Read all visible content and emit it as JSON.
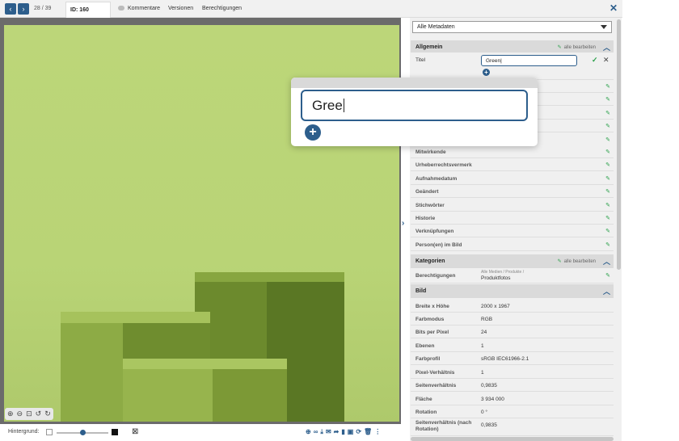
{
  "topbar": {
    "prev_icon": "chevron-left-icon",
    "next_icon": "chevron-right-icon",
    "counter": "28 / 39",
    "id_tab": "ID: 160",
    "tabs": [
      {
        "label": "Kommentare",
        "icon": "comment-icon"
      },
      {
        "label": "Versionen"
      },
      {
        "label": "Berechtigungen"
      }
    ],
    "close_icon": "close-icon"
  },
  "viewer": {
    "tools": [
      "zoom-in-icon",
      "zoom-out-icon",
      "fit-icon",
      "rotate-left-icon",
      "rotate-right-icon"
    ]
  },
  "bottombar": {
    "background_label": "Hintergrund:",
    "background_slider_level": 0.5,
    "actions": [
      "add-icon",
      "link-icon",
      "download-icon",
      "mail-icon",
      "share-icon",
      "import-icon",
      "print-icon",
      "refresh-icon",
      "delete-icon",
      "more-icon"
    ]
  },
  "panel": {
    "filter_select": "Alle Metadaten",
    "sections": {
      "allgemein": {
        "title": "Allgemein",
        "edit_all": "alle bearbeiten"
      },
      "kategorien": {
        "title": "Kategorien",
        "edit_all": "alle bearbeiten"
      },
      "bild": {
        "title": "Bild"
      }
    },
    "titel": {
      "label": "Titel",
      "value": "Green"
    },
    "allgemein_rows": [
      "Mitwirkende",
      "Urheberrechtsvermerk",
      "Aufnahmedatum",
      "Geändert",
      "Stichwörter",
      "Historie",
      "Verknüpfungen",
      "Person(en) im Bild"
    ],
    "berechtigungen": {
      "label": "Berechtigungen",
      "path": "Alle Medien / Produkte /",
      "value": "Produktfotos"
    },
    "bild_rows": [
      {
        "label": "Breite x Höhe",
        "value": "2000  x  1967"
      },
      {
        "label": "Farbmodus",
        "value": "RGB"
      },
      {
        "label": "Bits per Pixel",
        "value": "24"
      },
      {
        "label": "Ebenen",
        "value": "1"
      },
      {
        "label": "Farbprofil",
        "value": "sRGB IEC61966-2.1"
      },
      {
        "label": "Pixel-Verhältnis",
        "value": "1"
      },
      {
        "label": "Seitenverhältnis",
        "value": "0,9835"
      },
      {
        "label": "Fläche",
        "value": "3 934 000"
      },
      {
        "label": "Rotation",
        "value": "0 °"
      },
      {
        "label": "Seitenverhältnis (nach Rotation)",
        "value": "0,9835"
      }
    ]
  },
  "zoom_popup": {
    "input_value": "Gree"
  },
  "colors": {
    "accent": "#2d5e8c",
    "edit_green": "#2aa04a",
    "photo_bg": "#bdd87a"
  }
}
